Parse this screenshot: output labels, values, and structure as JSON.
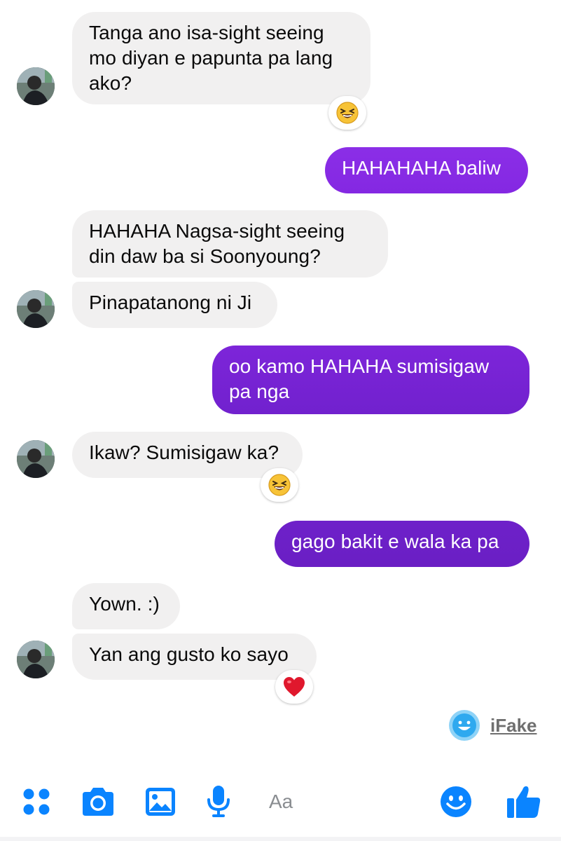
{
  "messages": [
    {
      "id": "m1",
      "side": "in",
      "text": "Tanga ano isa-sight seeing mo diyan e papunta pa lang ako?",
      "reaction": "laughing-emoji"
    },
    {
      "id": "m2",
      "side": "out",
      "text": "HAHAHAHA baliw"
    },
    {
      "id": "m3",
      "side": "in",
      "text": "HAHAHA Nagsa-sight seeing din daw ba si Soonyoung?"
    },
    {
      "id": "m4",
      "side": "in",
      "text": "Pinapatanong ni Ji"
    },
    {
      "id": "m5",
      "side": "out",
      "text": "oo kamo HAHAHA sumisigaw pa nga"
    },
    {
      "id": "m6",
      "side": "in",
      "text": "Ikaw? Sumisigaw ka?",
      "reaction": "laughing-emoji"
    },
    {
      "id": "m7",
      "side": "out",
      "text": "gago bakit e wala ka pa"
    },
    {
      "id": "m8",
      "side": "in",
      "text": "Yown. :)"
    },
    {
      "id": "m9",
      "side": "in",
      "text": "Yan ang gusto ko sayo",
      "reaction": "heart-emoji"
    }
  ],
  "watermark": {
    "label": "iFake"
  },
  "composer": {
    "placeholder": "Aa"
  },
  "icons": [
    "menu-dots-icon",
    "camera-icon",
    "gallery-icon",
    "microphone-icon",
    "smiley-icon",
    "thumbs-up-icon"
  ],
  "colors": {
    "incoming_bg": "#f1f0f0",
    "outgoing_gradient": [
      "#8a2be8",
      "#6b1fc4"
    ],
    "accent": "#0a84ff",
    "reaction_emoji": "#f7c337",
    "heart": "#e0182d"
  }
}
